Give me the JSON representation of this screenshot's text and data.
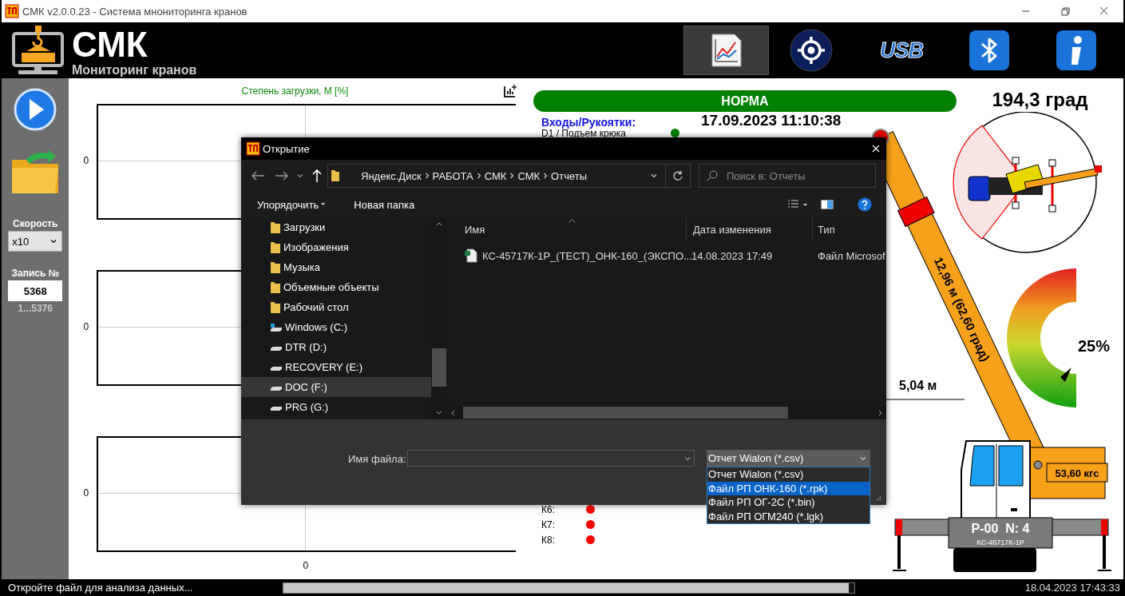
{
  "window": {
    "title": "СМК v2.0.0.23 - Система мнониторинга кранов"
  },
  "header": {
    "logo_title": "СМК",
    "logo_subtitle": "Мониторинг кранов",
    "buttons": [
      {
        "kind": "chart",
        "selected": true
      },
      {
        "kind": "target",
        "selected": false
      },
      {
        "kind": "usb",
        "label": "USB",
        "selected": false
      },
      {
        "kind": "bluetooth",
        "selected": false
      },
      {
        "kind": "info",
        "selected": false
      }
    ]
  },
  "sidebar": {
    "speed_label": "Скорость",
    "speed_value": "x10",
    "record_label": "Запись №",
    "record_value": "5368",
    "record_range": "1...5376"
  },
  "charts": {
    "title": "Степень загрузки, М [%]",
    "panels": [
      {
        "y_label": "0"
      },
      {
        "y_label": "0"
      },
      {
        "y_label": "0"
      }
    ],
    "x_label": "0"
  },
  "monitor": {
    "status": "НОРМА",
    "slew_angle": "194,3 град",
    "inputs_title": "Входы/Рукоятки:",
    "datetime": "17.09.2023 11:10:38",
    "inputs": [
      {
        "label": "D1 / Подъем крюка",
        "color": "#008000"
      }
    ],
    "relays": [
      {
        "label": "К6:",
        "color": "#ff0000"
      },
      {
        "label": "К7:",
        "color": "#ff0000"
      },
      {
        "label": "К8:",
        "color": "#ff0000"
      }
    ]
  },
  "crane": {
    "boom": "12,96 м (62,60 град)",
    "radius": "5,04 м",
    "load": "53,60 кгс",
    "load_percent": "25%",
    "plate": "Р-00  N: 4",
    "model": "КС-45717К-1Р"
  },
  "dialog": {
    "title": "Открытие",
    "path": [
      "Яндекс.Диск",
      "РАБОТА",
      "СМК",
      "СМК",
      "Отчеты"
    ],
    "search_placeholder": "Поиск в: Отчеты",
    "toolbar": [
      "Упорядочить",
      "Новая папка"
    ],
    "nav_items": [
      {
        "label": "Загрузки",
        "kind": "folder",
        "selected": false
      },
      {
        "label": "Изображения",
        "kind": "folder",
        "selected": false
      },
      {
        "label": "Музыка",
        "kind": "folder",
        "selected": false
      },
      {
        "label": "Объемные объекты",
        "kind": "folder",
        "selected": false
      },
      {
        "label": "Рабочий стол",
        "kind": "folder",
        "selected": false
      },
      {
        "label": "Windows (C:)",
        "kind": "system-drive",
        "selected": false
      },
      {
        "label": "DTR (D:)",
        "kind": "drive",
        "selected": false
      },
      {
        "label": "RECOVERY (E:)",
        "kind": "drive",
        "selected": false
      },
      {
        "label": "DOC (F:)",
        "kind": "drive",
        "selected": true
      },
      {
        "label": "PRG (G:)",
        "kind": "drive",
        "selected": false
      }
    ],
    "columns": [
      "Имя",
      "Дата изменения",
      "Тип"
    ],
    "files": [
      {
        "name": "КС-45717К-1Р_(ТЕСТ)_ОНК-160_(ЭКСПО...",
        "date": "14.08.2023 17:49",
        "type": "Файл Microsof"
      }
    ],
    "filename_label": "Имя файла:",
    "filter": {
      "value": "Отчет Wialon (*.csv)",
      "options": [
        {
          "label": "Отчет Wialon (*.csv)",
          "highlighted": false
        },
        {
          "label": "Файл РП ОНК-160 (*.rpk)",
          "highlighted": true
        },
        {
          "label": "Файл РП ОГ-2С (*.bin)",
          "highlighted": false
        },
        {
          "label": "Файл РП ОГМ240 (*.lgk)",
          "highlighted": false
        }
      ]
    }
  },
  "status_bar": {
    "message": "Откройте файл для анализа данных...",
    "progress": {
      "level": 0.99
    },
    "datetime": "18.04.2023 17:43:33"
  }
}
